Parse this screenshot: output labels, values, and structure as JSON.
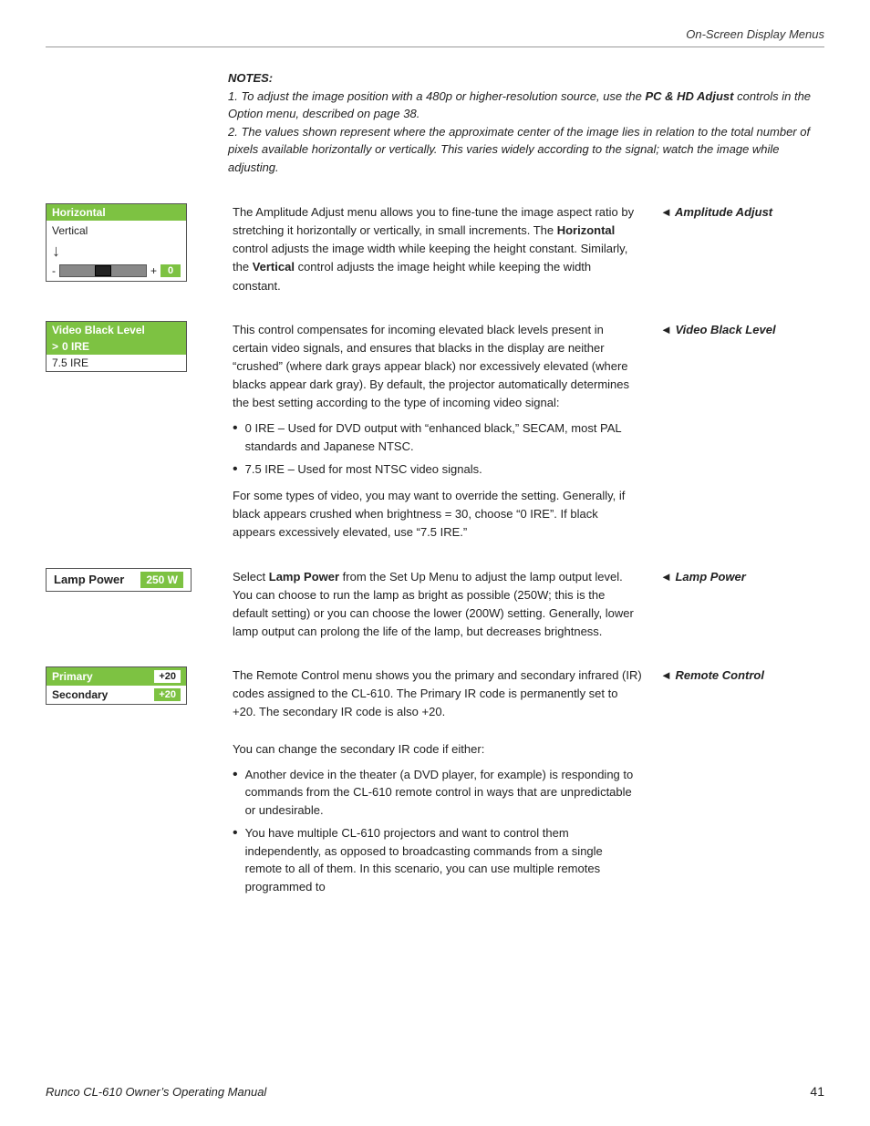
{
  "header": {
    "title": "On-Screen Display Menus",
    "rule": true
  },
  "notes": {
    "title": "NOTES:",
    "items": [
      "1. To adjust the image position with a 480p or higher-resolution source, use the PC & HD Adjust controls in the Option menu, described on page 38.",
      "2. The values shown represent where the approximate center of the image lies in relation to the total number of pixels available horizontally or vertically. This varies widely according to the signal; watch the image while adjusting."
    ]
  },
  "sections": [
    {
      "id": "amplitude-adjust",
      "menu": {
        "type": "amplitude",
        "header": "Horizontal",
        "subitem": "Vertical",
        "slider_minus": "-",
        "slider_plus": "+",
        "slider_value": "0"
      },
      "right_label": "Amplitude Adjust",
      "description": "The Amplitude Adjust menu allows you to fine-tune the image aspect ratio by stretching it horizontally or vertically, in small increments. The Horizontal control adjusts the image width while keeping the height constant. Similarly, the Vertical control adjusts the image height while keeping the width constant."
    },
    {
      "id": "video-black-level",
      "menu": {
        "type": "vbl",
        "header": "Video Black Level",
        "items": [
          {
            "label": "0 IRE",
            "selected": true,
            "arrow": true
          },
          {
            "label": "7.5 IRE",
            "selected": false,
            "arrow": false
          }
        ]
      },
      "right_label": "Video Black Level",
      "description_parts": [
        "This control compensates for incoming elevated black levels present in certain video signals, and ensures that blacks in the display are neither “crushed” (where dark grays appear black) nor excessively elevated (where blacks appear dark gray). By default, the projector automatically determines the best setting according to the type of incoming video signal:"
      ],
      "bullets": [
        "0 IRE – Used for DVD output with “enhanced black,” SECAM, most PAL standards and Japanese NTSC.",
        "7.5 IRE – Used for most NTSC video signals."
      ],
      "description_after": "For some types of video, you may want to override the setting. Generally, if black appears crushed when brightness = 30, choose “0 IRE”. If black appears excessively elevated, use “7.5 IRE.”"
    },
    {
      "id": "lamp-power",
      "menu": {
        "type": "lamp",
        "label": "Lamp Power",
        "value": "250 W"
      },
      "right_label": "Lamp Power",
      "description": "Select Lamp Power from the Set Up Menu to adjust the lamp output level. You can choose to run the lamp as bright as possible (250W; this is the default setting) or you can choose the lower (200W) setting. Generally, lower lamp output can prolong the life of the lamp, but decreases brightness."
    },
    {
      "id": "remote-control",
      "menu": {
        "type": "rc",
        "rows": [
          {
            "label": "Primary",
            "value": "+20",
            "is_primary": true
          },
          {
            "label": "Secondary",
            "value": "+20",
            "is_primary": false
          }
        ]
      },
      "right_label": "Remote Control",
      "description_parts": [
        "The Remote Control menu shows you the primary and secondary infrared (IR) codes assigned to the CL-610. The Primary IR code is permanently set to +20. The secondary IR code is also +20.",
        "You can change the secondary IR code if either:"
      ],
      "bullets": [
        "Another device in the theater (a DVD player, for example) is responding to commands from the CL-610 remote control in ways that are unpredictable or undesirable.",
        "You have multiple CL-610 projectors and want to control them independently, as opposed to broadcasting commands from a single remote to all of them. In this scenario, you can use multiple remotes programmed to"
      ]
    }
  ],
  "footer": {
    "left": "Runco CL-610 Owner’s Operating Manual",
    "page": "41"
  }
}
